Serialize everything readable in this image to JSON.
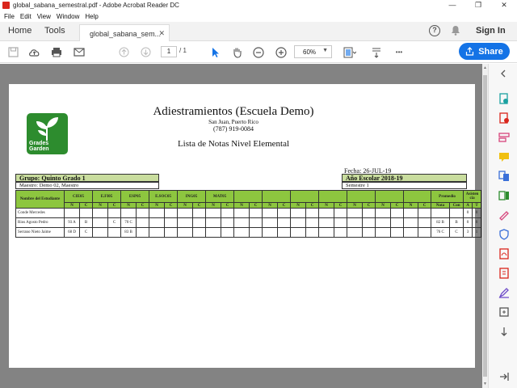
{
  "window": {
    "title": "global_sabana_semestral.pdf - Adobe Acrobat Reader DC",
    "min": "—",
    "max": "❐",
    "close": "✕"
  },
  "menu": [
    "File",
    "Edit",
    "View",
    "Window",
    "Help"
  ],
  "tabs": {
    "home": "Home",
    "tools": "Tools",
    "doc": "global_sabana_sem...",
    "doc_close": "✕"
  },
  "header": {
    "help": "?",
    "signin": "Sign In"
  },
  "toolbar": {
    "page_current": "1",
    "page_total": "/  1",
    "zoom": "60%",
    "share": "Share",
    "more": "•••"
  },
  "document": {
    "logo_text_1": "Grades",
    "logo_text_2": "Garden",
    "title": "Adiestramientos (Escuela Demo)",
    "city": "San Juan, Puerto Rico",
    "phone": "(787) 919-0084",
    "subtitle": "Lista de Notas Nivel Elemental",
    "fecha": "Fecha: 26-JUL-19",
    "grupo": "Grupo: Quinto Grado 1",
    "maestro": "Maestro: Demo 02, Maestro",
    "ano": "Año Escolar 2018-19",
    "semestre": "Semestre 1",
    "table": {
      "name_header": "Nombre del Estudiante",
      "subjects": [
        "CIE05",
        "E.FI05",
        "ESP05",
        "E.SOC05",
        "ING05",
        "MAT05"
      ],
      "promedio": "Promedio",
      "asistencia": "Asisten cia",
      "sub_n": "N",
      "sub_c": "C",
      "nota": "Nota",
      "con": "Con",
      "a": "A",
      "t": "T",
      "rows": [
        {
          "name": "Conde Mercedes",
          "cells": [
            "",
            "",
            "",
            "",
            "",
            "",
            "",
            ""
          ],
          "nota": "",
          "con": "",
          "a": "0",
          "t": "0"
        },
        {
          "name": "Rios Agosto Pedro",
          "cells": [
            "93 A",
            "B",
            "",
            "C",
            "70 C",
            "",
            "",
            ""
          ],
          "nota": "82 B",
          "con": "B",
          "a": "0",
          "t": "0"
        },
        {
          "name": "Serrano Nieto Jaime",
          "cells": [
            "68 D",
            "C",
            "",
            "",
            "83 B",
            "",
            "",
            ""
          ],
          "nota": "76 C",
          "con": "C",
          "a": "3",
          "t": "1"
        }
      ]
    }
  }
}
